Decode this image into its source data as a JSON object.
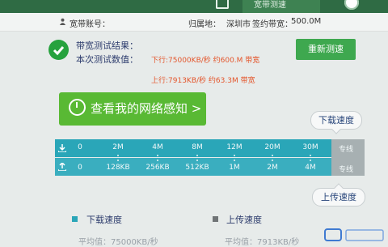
{
  "nav": {
    "tab_label": "宽带测速"
  },
  "info": {
    "account_label": "宽带账号：",
    "location_label": "归属地：",
    "location_value": "深圳市",
    "contract_label": "签约带宽：",
    "contract_value": "500.0M"
  },
  "result": {
    "title": "带宽测试结果：",
    "subtitle": "本次测试数值：",
    "download_text": "下行:75000KB/秒 约600.M 带宽",
    "upload_text": "上行:7913KB/秒 约63.3M 带宽",
    "retest_label": "重新测速"
  },
  "network_button": "查看我的网络感知 >",
  "download_pill": "下载速度",
  "upload_pill": "上传速度",
  "scale": {
    "download_ticks": [
      "0",
      "2M",
      "4M",
      "8M",
      "12M",
      "20M",
      "30M",
      "专线"
    ],
    "upload_ticks": [
      "0",
      "128KB",
      "256KB",
      "512KB",
      "1M",
      "2M",
      "4M",
      "专线"
    ]
  },
  "legend": {
    "download_label": "下载速度",
    "download_avg": "平均值：75000KB/秒",
    "upload_label": "上传速度",
    "upload_avg": "平均值：7913KB/秒"
  },
  "colors": {
    "nav_green": "#2f6b44",
    "accent_green": "#3ea84f",
    "highlight_red": "#e4552b",
    "scale_teal": "#2aa6b8",
    "download_legend": "#2aa6b8",
    "upload_legend": "#707476"
  }
}
